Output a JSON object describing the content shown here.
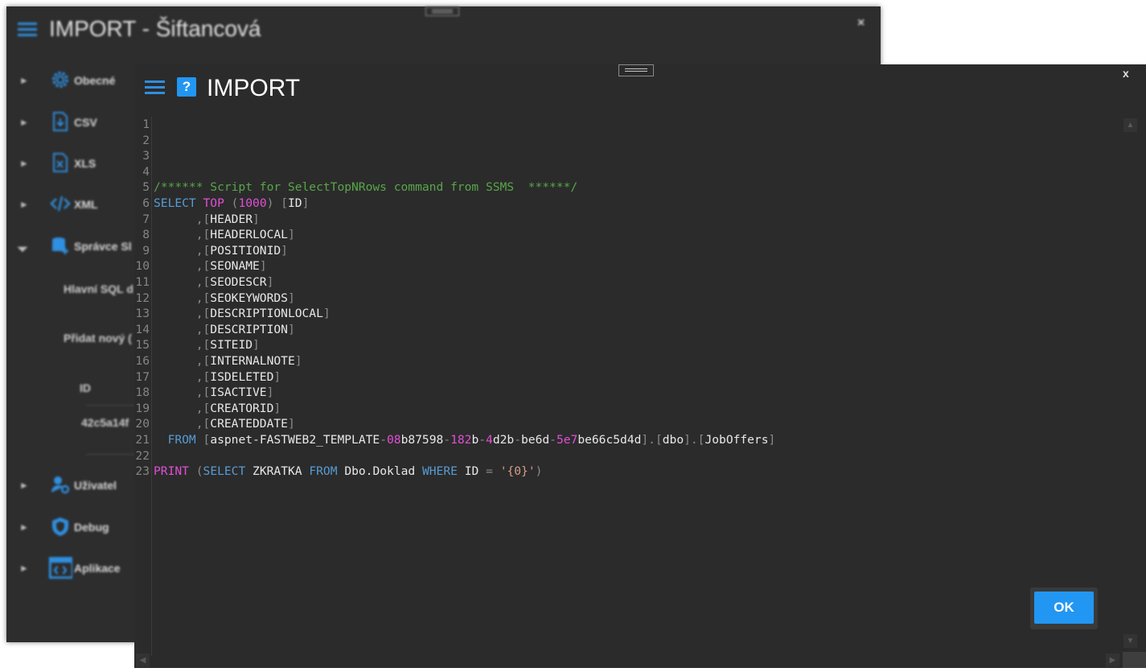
{
  "background_window": {
    "title": "IMPORT - Šiftancová",
    "close_label": "×",
    "nav": [
      {
        "label": "Obecné",
        "icon": "gear-icon"
      },
      {
        "label": "CSV",
        "icon": "csv-file-icon"
      },
      {
        "label": "XLS",
        "icon": "xls-file-icon"
      },
      {
        "label": "XML",
        "icon": "code-icon"
      },
      {
        "label": "Správce Sl",
        "icon": "database-add-icon"
      },
      {
        "label": "Uživatel",
        "icon": "user-settings-icon"
      },
      {
        "label": "Debug",
        "icon": "shield-icon"
      },
      {
        "label": "Aplikace",
        "icon": "app-window-icon"
      }
    ],
    "sub_items": {
      "main_sql": "Hlavní SQL d",
      "add_new": "Přidat nový (",
      "id_header": "ID",
      "id_value": "42c5a14f"
    }
  },
  "dialog": {
    "title": "IMPORT",
    "close_label": "x",
    "ok_label": "OK",
    "colors": {
      "accent": "#2196f3",
      "background": "#2b2b2b"
    }
  },
  "editor": {
    "line_numbers": [
      "1",
      "2",
      "3",
      "4",
      "5",
      "6",
      "7",
      "8",
      "9",
      "10",
      "11",
      "12",
      "13",
      "14",
      "15",
      "16",
      "17",
      "18",
      "19",
      "20",
      "21",
      "22",
      "23"
    ],
    "lines": [
      [],
      [],
      [],
      [],
      [
        {
          "t": "/****** Script for SelectTopNRows command from SSMS  ******/",
          "c": "k-green"
        }
      ],
      [
        {
          "t": "SELECT",
          "c": "k-blue"
        },
        {
          "t": " "
        },
        {
          "t": "TOP",
          "c": "k-pink"
        },
        {
          "t": " "
        },
        {
          "t": "(",
          "c": "k-gray"
        },
        {
          "t": "1000",
          "c": "k-pink"
        },
        {
          "t": ")",
          "c": "k-gray"
        },
        {
          "t": " "
        },
        {
          "t": "[",
          "c": "k-gray"
        },
        {
          "t": "ID",
          "c": "k-white"
        },
        {
          "t": "]",
          "c": "k-gray"
        }
      ],
      [
        {
          "t": "      "
        },
        {
          "t": ",[",
          "c": "k-gray"
        },
        {
          "t": "HEADER",
          "c": "k-white"
        },
        {
          "t": "]",
          "c": "k-gray"
        }
      ],
      [
        {
          "t": "      "
        },
        {
          "t": ",[",
          "c": "k-gray"
        },
        {
          "t": "HEADERLOCAL",
          "c": "k-white"
        },
        {
          "t": "]",
          "c": "k-gray"
        }
      ],
      [
        {
          "t": "      "
        },
        {
          "t": ",[",
          "c": "k-gray"
        },
        {
          "t": "POSITIONID",
          "c": "k-white"
        },
        {
          "t": "]",
          "c": "k-gray"
        }
      ],
      [
        {
          "t": "      "
        },
        {
          "t": ",[",
          "c": "k-gray"
        },
        {
          "t": "SEONAME",
          "c": "k-white"
        },
        {
          "t": "]",
          "c": "k-gray"
        }
      ],
      [
        {
          "t": "      "
        },
        {
          "t": ",[",
          "c": "k-gray"
        },
        {
          "t": "SEODESCR",
          "c": "k-white"
        },
        {
          "t": "]",
          "c": "k-gray"
        }
      ],
      [
        {
          "t": "      "
        },
        {
          "t": ",[",
          "c": "k-gray"
        },
        {
          "t": "SEOKEYWORDS",
          "c": "k-white"
        },
        {
          "t": "]",
          "c": "k-gray"
        }
      ],
      [
        {
          "t": "      "
        },
        {
          "t": ",[",
          "c": "k-gray"
        },
        {
          "t": "DESCRIPTIONLOCAL",
          "c": "k-white"
        },
        {
          "t": "]",
          "c": "k-gray"
        }
      ],
      [
        {
          "t": "      "
        },
        {
          "t": ",[",
          "c": "k-gray"
        },
        {
          "t": "DESCRIPTION",
          "c": "k-white"
        },
        {
          "t": "]",
          "c": "k-gray"
        }
      ],
      [
        {
          "t": "      "
        },
        {
          "t": ",[",
          "c": "k-gray"
        },
        {
          "t": "SITEID",
          "c": "k-white"
        },
        {
          "t": "]",
          "c": "k-gray"
        }
      ],
      [
        {
          "t": "      "
        },
        {
          "t": ",[",
          "c": "k-gray"
        },
        {
          "t": "INTERNALNOTE",
          "c": "k-white"
        },
        {
          "t": "]",
          "c": "k-gray"
        }
      ],
      [
        {
          "t": "      "
        },
        {
          "t": ",[",
          "c": "k-gray"
        },
        {
          "t": "ISDELETED",
          "c": "k-white"
        },
        {
          "t": "]",
          "c": "k-gray"
        }
      ],
      [
        {
          "t": "      "
        },
        {
          "t": ",[",
          "c": "k-gray"
        },
        {
          "t": "ISACTIVE",
          "c": "k-white"
        },
        {
          "t": "]",
          "c": "k-gray"
        }
      ],
      [
        {
          "t": "      "
        },
        {
          "t": ",[",
          "c": "k-gray"
        },
        {
          "t": "CREATORID",
          "c": "k-white"
        },
        {
          "t": "]",
          "c": "k-gray"
        }
      ],
      [
        {
          "t": "      "
        },
        {
          "t": ",[",
          "c": "k-gray"
        },
        {
          "t": "CREATEDDATE",
          "c": "k-white"
        },
        {
          "t": "]",
          "c": "k-gray"
        }
      ],
      [
        {
          "t": "  "
        },
        {
          "t": "FROM",
          "c": "k-blue"
        },
        {
          "t": " "
        },
        {
          "t": "[",
          "c": "k-gray"
        },
        {
          "t": "aspnet-FASTWEB2_TEMPLATE",
          "c": "k-white"
        },
        {
          "t": "-",
          "c": "k-gray"
        },
        {
          "t": "08",
          "c": "k-pink"
        },
        {
          "t": "b87598",
          "c": "k-white"
        },
        {
          "t": "-",
          "c": "k-gray"
        },
        {
          "t": "182",
          "c": "k-pink"
        },
        {
          "t": "b",
          "c": "k-white"
        },
        {
          "t": "-",
          "c": "k-gray"
        },
        {
          "t": "4",
          "c": "k-pink"
        },
        {
          "t": "d2b",
          "c": "k-white"
        },
        {
          "t": "-",
          "c": "k-gray"
        },
        {
          "t": "be6d",
          "c": "k-white"
        },
        {
          "t": "-",
          "c": "k-gray"
        },
        {
          "t": "5e7",
          "c": "k-pink"
        },
        {
          "t": "be66c5d4d",
          "c": "k-white"
        },
        {
          "t": "].[",
          "c": "k-gray"
        },
        {
          "t": "dbo",
          "c": "k-white"
        },
        {
          "t": "].[",
          "c": "k-gray"
        },
        {
          "t": "JobOffers",
          "c": "k-white"
        },
        {
          "t": "]",
          "c": "k-gray"
        }
      ],
      [],
      [
        {
          "t": "PRINT",
          "c": "k-pink"
        },
        {
          "t": " "
        },
        {
          "t": "(",
          "c": "k-gray"
        },
        {
          "t": "SELECT",
          "c": "k-blue"
        },
        {
          "t": " "
        },
        {
          "t": "ZKRATKA",
          "c": "k-white"
        },
        {
          "t": " "
        },
        {
          "t": "FROM",
          "c": "k-blue"
        },
        {
          "t": " "
        },
        {
          "t": "Dbo.Doklad",
          "c": "k-white"
        },
        {
          "t": " "
        },
        {
          "t": "WHERE",
          "c": "k-blue"
        },
        {
          "t": " "
        },
        {
          "t": "ID",
          "c": "k-white"
        },
        {
          "t": " "
        },
        {
          "t": "=",
          "c": "k-gray"
        },
        {
          "t": " "
        },
        {
          "t": "'{0}'",
          "c": "k-str"
        },
        {
          "t": ")",
          "c": "k-gray"
        }
      ]
    ]
  }
}
